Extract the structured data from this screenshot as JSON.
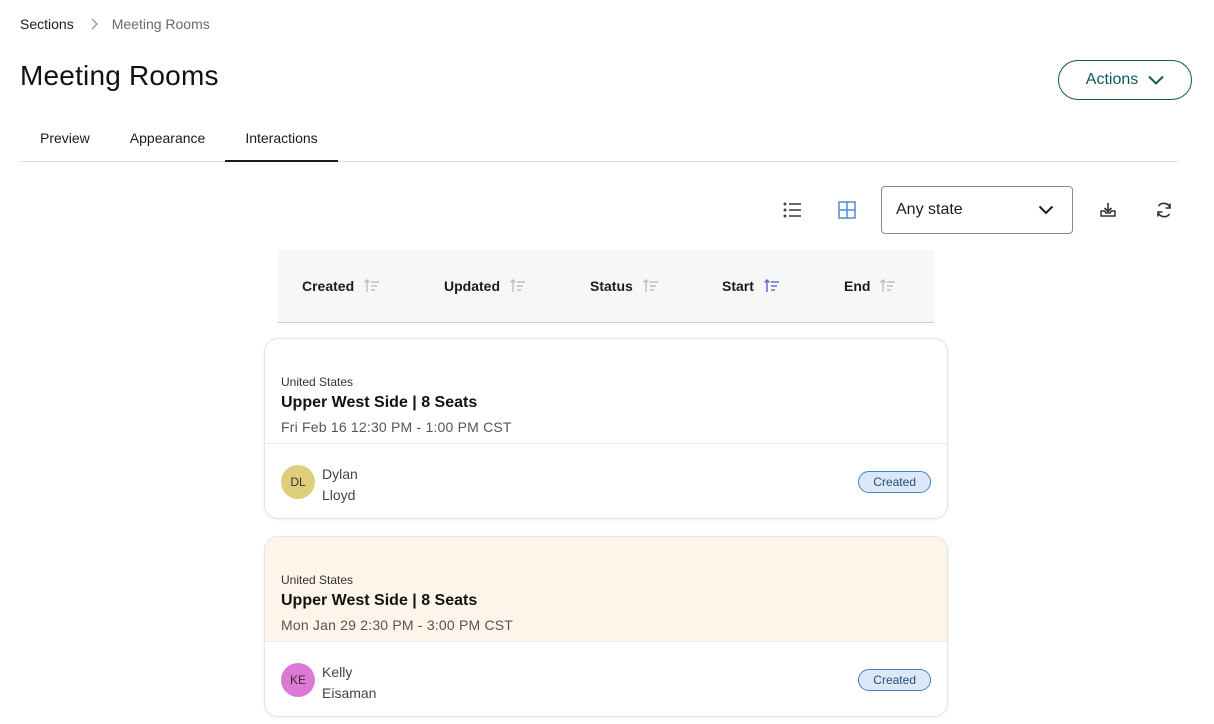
{
  "breadcrumb": {
    "parent": "Sections",
    "current": "Meeting Rooms"
  },
  "page": {
    "title": "Meeting Rooms"
  },
  "header": {
    "actions_label": "Actions"
  },
  "tabs": [
    {
      "label": "Preview",
      "active": false
    },
    {
      "label": "Appearance",
      "active": false
    },
    {
      "label": "Interactions",
      "active": true
    }
  ],
  "toolbar": {
    "list_view_icon": "list-icon",
    "grid_view_icon": "grid-icon",
    "state_filter": {
      "selected": "Any state"
    },
    "download_icon": "download-icon",
    "refresh_icon": "refresh-icon"
  },
  "columns": [
    {
      "label": "Created",
      "sort_active": false
    },
    {
      "label": "Updated",
      "sort_active": false
    },
    {
      "label": "Status",
      "sort_active": false
    },
    {
      "label": "Start",
      "sort_active": true
    },
    {
      "label": "End",
      "sort_active": false
    }
  ],
  "cards": [
    {
      "country": "United States",
      "title": "Upper West Side | 8 Seats",
      "time": "Fri Feb 16 12:30 PM - 1:00 PM CST",
      "initials": "DL",
      "first_name": "Dylan",
      "last_name": "Lloyd",
      "status": "Created",
      "avatar_color": "#ddcf7a",
      "highlighted": false
    },
    {
      "country": "United States",
      "title": "Upper West Side | 8 Seats",
      "time": "Mon Jan 29 2:30 PM - 3:00 PM CST",
      "initials": "KE",
      "first_name": "Kelly",
      "last_name": "Eisaman",
      "status": "Created",
      "avatar_color": "#dc79d4",
      "highlighted": true
    }
  ],
  "colors": {
    "accent": "#0e5a5a",
    "active_icon": "#5b8fd6",
    "highlight_bg": "#fdf4ea",
    "badge_bg": "#dbe8f7",
    "badge_border": "#4a7fc0"
  }
}
